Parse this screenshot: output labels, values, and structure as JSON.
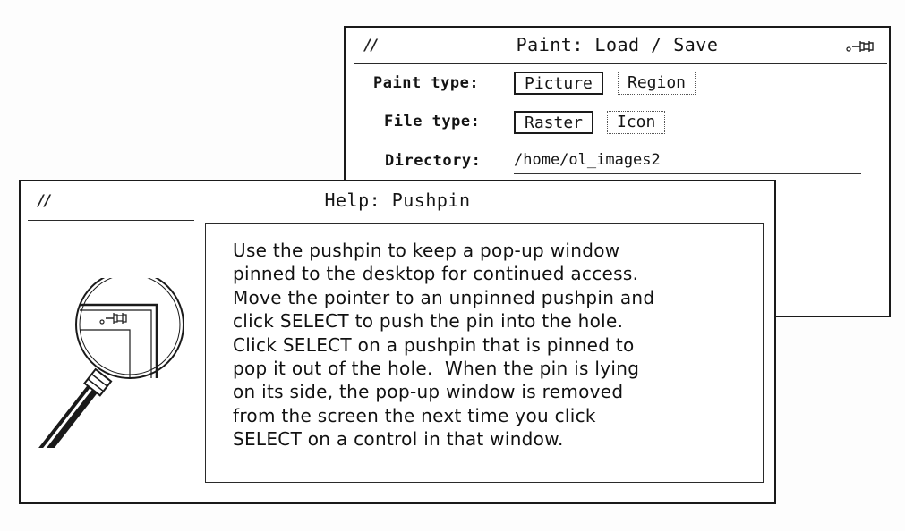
{
  "paint_window": {
    "title": "Paint: Load / Save",
    "menu_mark": "//",
    "paint_type": {
      "label": "Paint type:",
      "options": [
        "Picture",
        "Region"
      ],
      "selected": "Picture"
    },
    "file_type": {
      "label": "File type:",
      "options": [
        "Raster",
        "Icon"
      ],
      "selected": "Raster"
    },
    "directory": {
      "label": "Directory:",
      "value": "/home/ol_images2"
    }
  },
  "help_window": {
    "title": "Help: Pushpin",
    "menu_mark": "//",
    "lines": [
      "Use the pushpin to keep a pop-up window",
      "pinned to the desktop for continued access.",
      "Move the pointer to an unpinned pushpin and",
      "click SELECT to push the pin into the hole.",
      "Click SELECT on a pushpin that is pinned to",
      "pop it out of the hole.  When the pin is lying",
      "on its side, the pop-up window is removed",
      "from the screen the next time you click",
      "SELECT on a control in that window."
    ]
  },
  "icons": {
    "pushpin": "pushpin-icon",
    "magnifier": "magnifying-glass-icon",
    "window_menu": "window-menu-icon"
  }
}
